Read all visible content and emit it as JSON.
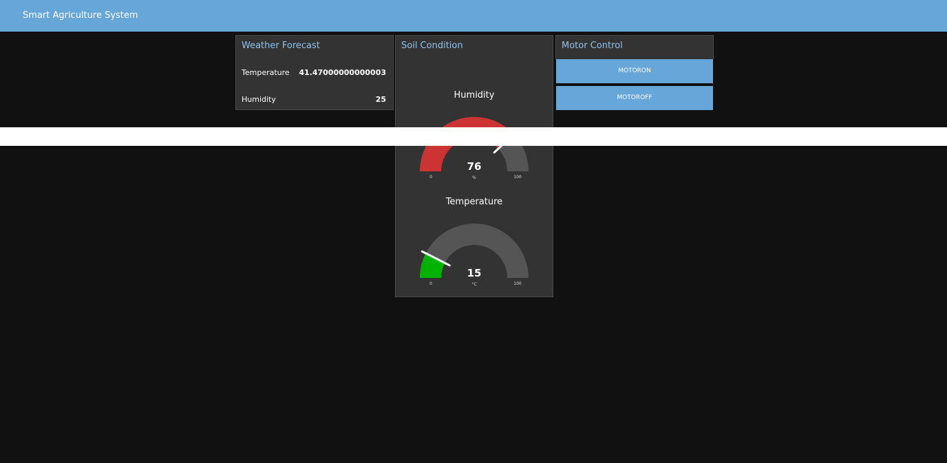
{
  "header": {
    "title": "Smart Agriculture System"
  },
  "weather": {
    "title": "Weather Forecast",
    "rows": [
      {
        "label": "Temperature",
        "value": "41.47000000000003"
      },
      {
        "label": "Humidity",
        "value": "25"
      }
    ]
  },
  "soil": {
    "title": "Soil Condition",
    "gauges": [
      {
        "title": "Humidity",
        "value": 76,
        "value_text": "76",
        "unit": "%",
        "min": 0,
        "max": 100,
        "min_text": "0",
        "max_text": "100",
        "fill_color": "#cc3333"
      },
      {
        "title": "Temperature",
        "value": 15,
        "value_text": "15",
        "unit": "°C",
        "min": 0,
        "max": 100,
        "min_text": "0",
        "max_text": "100",
        "fill_color": "#00b200"
      }
    ]
  },
  "motor": {
    "title": "Motor Control",
    "on_label": "MOTORON",
    "off_label": "MOTOROFF"
  },
  "colors": {
    "accent": "#67a6d8",
    "card_bg": "#333333",
    "page_bg": "#111111",
    "gauge_track": "#555555"
  }
}
